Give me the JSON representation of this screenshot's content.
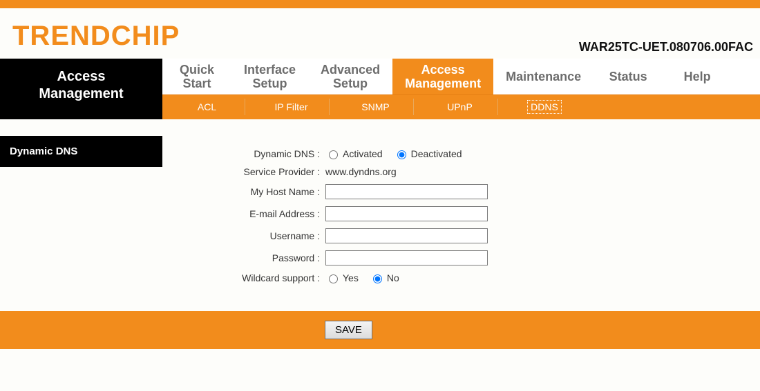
{
  "brand": "TRENDCHIP",
  "model": "WAR25TC-UET.080706.00FAC",
  "section_title_line1": "Access",
  "section_title_line2": "Management",
  "tabs": [
    {
      "line1": "Quick",
      "line2": "Start",
      "active": false
    },
    {
      "line1": "Interface",
      "line2": "Setup",
      "active": false
    },
    {
      "line1": "Advanced",
      "line2": "Setup",
      "active": false
    },
    {
      "line1": "Access",
      "line2": "Management",
      "active": true
    },
    {
      "line1": "Maintenance",
      "line2": "",
      "active": false
    },
    {
      "line1": "Status",
      "line2": "",
      "active": false
    },
    {
      "line1": "Help",
      "line2": "",
      "active": false
    }
  ],
  "subtabs": [
    {
      "label": "ACL",
      "active": false
    },
    {
      "label": "IP Filter",
      "active": false
    },
    {
      "label": "SNMP",
      "active": false
    },
    {
      "label": "UPnP",
      "active": false
    },
    {
      "label": "DDNS",
      "active": true
    }
  ],
  "side_title": "Dynamic DNS",
  "form": {
    "dynamic_dns": {
      "label": "Dynamic DNS :",
      "opt1": "Activated",
      "opt2": "Deactivated",
      "selected": "Deactivated"
    },
    "service_provider": {
      "label": "Service Provider :",
      "value": "www.dyndns.org"
    },
    "host_name": {
      "label": "My Host Name :",
      "value": ""
    },
    "email": {
      "label": "E-mail Address :",
      "value": ""
    },
    "username": {
      "label": "Username :",
      "value": ""
    },
    "password": {
      "label": "Password :",
      "value": ""
    },
    "wildcard": {
      "label": "Wildcard support :",
      "opt1": "Yes",
      "opt2": "No",
      "selected": "No"
    }
  },
  "save_label": "SAVE"
}
